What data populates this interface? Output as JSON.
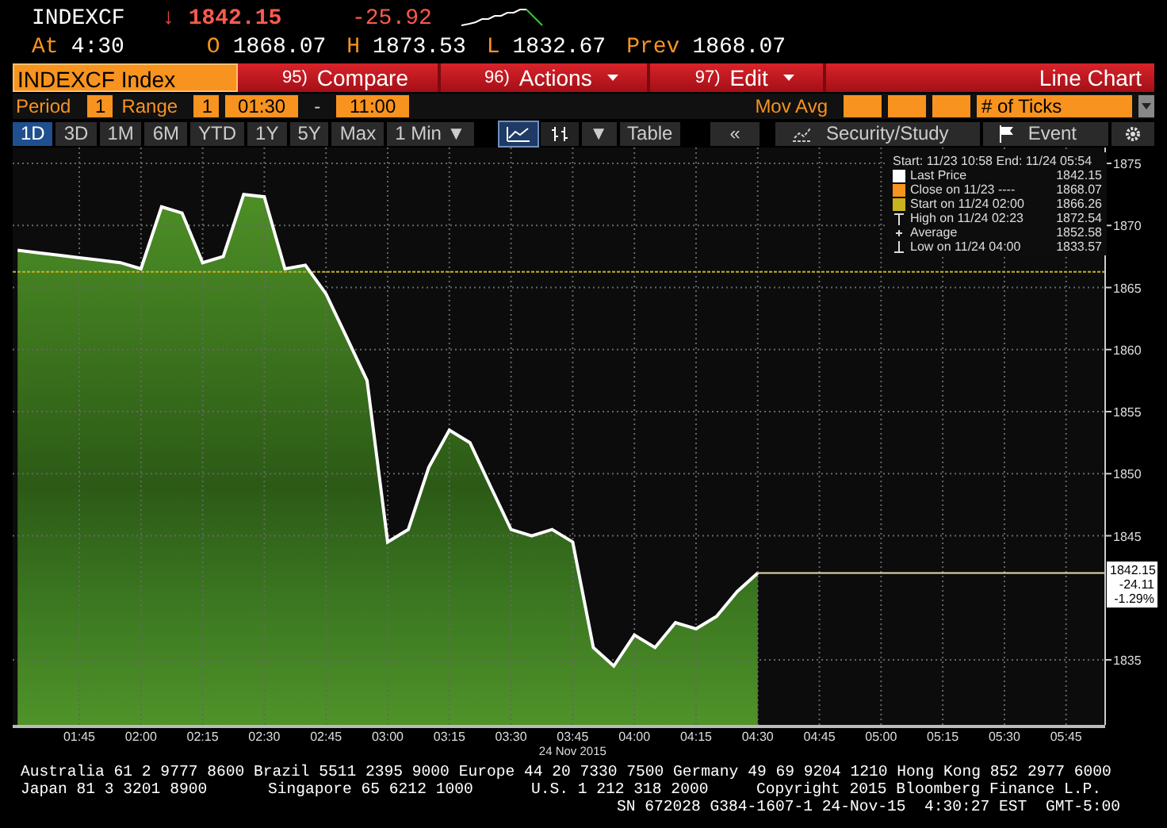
{
  "quote": {
    "symbol": "INDEXCF",
    "arrow": "↓",
    "last": "1842.15",
    "change": "-25.92"
  },
  "stats": [
    {
      "label": "At",
      "value": "4:30"
    },
    {
      "label": "O",
      "value": "1868.07"
    },
    {
      "label": "H",
      "value": "1873.53"
    },
    {
      "label": "L",
      "value": "1832.67"
    },
    {
      "label": "Prev",
      "value": "1868.07"
    }
  ],
  "toolbar": {
    "security": "INDEXCF Index",
    "buttons": [
      {
        "number": "95)",
        "label": "Compare",
        "dropdown": false
      },
      {
        "number": "96)",
        "label": "Actions",
        "dropdown": true
      },
      {
        "number": "97)",
        "label": "Edit",
        "dropdown": true
      }
    ],
    "chart_type": "Line Chart"
  },
  "settings": {
    "period_label": "Period",
    "period": "1",
    "range_label": "Range",
    "range": "1",
    "start": "01:30",
    "separator": "-",
    "end": "11:00",
    "mov_avg_label": "Mov Avg",
    "ticks": "# of Ticks"
  },
  "ranges": [
    {
      "label": "1D",
      "selected": true
    },
    {
      "label": "3D",
      "selected": false
    },
    {
      "label": "1M",
      "selected": false
    },
    {
      "label": "6M",
      "selected": false
    },
    {
      "label": "YTD",
      "selected": false
    },
    {
      "label": "1Y",
      "selected": false
    },
    {
      "label": "5Y",
      "selected": false
    },
    {
      "label": "Max",
      "selected": false
    }
  ],
  "interval": "1 Min ▼",
  "tools": [
    {
      "kind": "line",
      "selected": true
    },
    {
      "kind": "bars",
      "selected": false
    }
  ],
  "tool_menu": "▼",
  "table": "Table",
  "back": "«",
  "study": "Security/Study",
  "event": "Event",
  "legend": {
    "header": "Start: 11/23 10:58 End: 11/24 05:54",
    "items": [
      {
        "kind": "swatch",
        "color": "#ffffff",
        "label": "Last Price",
        "value": "1842.15"
      },
      {
        "kind": "swatch",
        "color": "#f7931e",
        "label": "Close on 11/23 ----",
        "value": "1868.07"
      },
      {
        "kind": "swatch",
        "color": "#c8b21e",
        "label": "Start on 11/24 02:00",
        "value": "1866.26"
      },
      {
        "kind": "high",
        "label": "High on 11/24 02:23",
        "value": "1872.54"
      },
      {
        "kind": "average",
        "label": "Average",
        "value": "1852.58"
      },
      {
        "kind": "low",
        "label": "Low on 11/24 04:00",
        "value": "1833.57"
      }
    ]
  },
  "last_tag": [
    "1842.15",
    "-24.11",
    "-1.29%"
  ],
  "chart_data": {
    "type": "area",
    "x": [
      90,
      95,
      100,
      105,
      110,
      115,
      120,
      125,
      130,
      135,
      140,
      145,
      150,
      155,
      160,
      165,
      170,
      175,
      180,
      185,
      190,
      195,
      200,
      205,
      210,
      215,
      220,
      225,
      230,
      235,
      240,
      245,
      250,
      255,
      260,
      265,
      270
    ],
    "series": [
      {
        "color": "#ffffff",
        "values": [
          1868.0,
          1867.8,
          1867.6,
          1867.4,
          1867.2,
          1867.0,
          1866.5,
          1871.5,
          1871.0,
          1867.0,
          1867.5,
          1872.5,
          1872.3,
          1866.5,
          1866.8,
          1864.5,
          1861.0,
          1857.5,
          1844.5,
          1845.5,
          1850.5,
          1853.5,
          1852.5,
          1849.0,
          1845.5,
          1845.0,
          1845.5,
          1844.5,
          1836.0,
          1834.5,
          1837.0,
          1836.0,
          1838.0,
          1837.5,
          1838.5,
          1840.5,
          1842.0
        ]
      }
    ],
    "xlim": [
      88.8,
      354.5
    ],
    "ylim": [
      1829.76,
      1876.28
    ],
    "xticks": [
      {
        "value": 105,
        "label": "01:45"
      },
      {
        "value": 120,
        "label": "02:00"
      },
      {
        "value": 135,
        "label": "02:15"
      },
      {
        "value": 150,
        "label": "02:30"
      },
      {
        "value": 165,
        "label": "02:45"
      },
      {
        "value": 180,
        "label": "03:00"
      },
      {
        "value": 195,
        "label": "03:15"
      },
      {
        "value": 210,
        "label": "03:30"
      },
      {
        "value": 225,
        "label": "03:45"
      },
      {
        "value": 240,
        "label": "04:00"
      },
      {
        "value": 255,
        "label": "04:15"
      },
      {
        "value": 270,
        "label": "04:30"
      },
      {
        "value": 285,
        "label": "04:45"
      },
      {
        "value": 300,
        "label": "05:00"
      },
      {
        "value": 315,
        "label": "05:15"
      },
      {
        "value": 330,
        "label": "05:30"
      },
      {
        "value": 345,
        "label": "05:45"
      }
    ],
    "yticks": [
      1835,
      1845,
      1850,
      1855,
      1860,
      1865,
      1870,
      1875
    ],
    "grid": true,
    "ref_lines": [
      {
        "axis": "y",
        "value": 1866.26,
        "color": "#c8b21e"
      }
    ]
  },
  "date_label": "24 Nov 2015",
  "footer": [
    "Australia 61 2 9777 8600 Brazil 5511 2395 9000 Europe 44 20 7330 7500 Germany 49 69 9204 1210 Hong Kong 852 2977 6000",
    "Japan 81 3 3201 8900",
    "Singapore 65 6212 1000",
    "U.S. 1 212 318 2000",
    "Copyright 2015 Bloomberg Finance L.P.",
    "SN 672028 G384-1607-1 24-Nov-15  4:30:27 EST  GMT-5:00"
  ]
}
